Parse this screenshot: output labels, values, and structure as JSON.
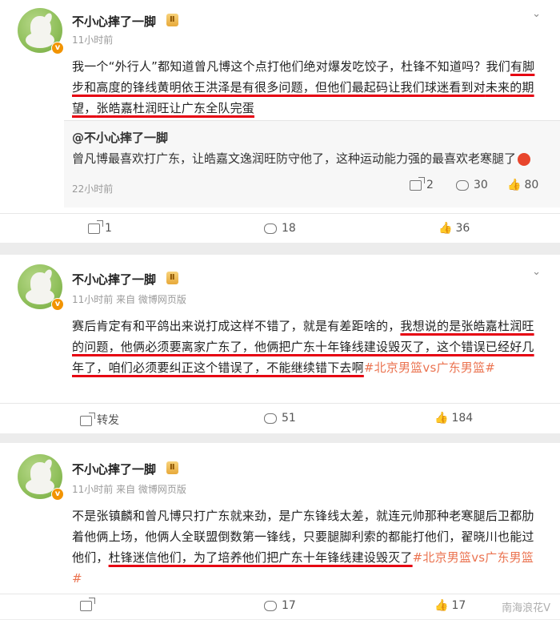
{
  "posts": [
    {
      "user": "不小心摔了一脚",
      "level_badge": "Ⅱ",
      "verify_badge": "v",
      "meta": "11小时前",
      "text": {
        "p1": "我一个“外行人”都知道曾凡博这个点打他们绝对爆发吃饺子，杜锋不知道吗？我们",
        "p2": "有脚步和高度的锋线黄明依王洪泽是有很多问题，但他们最起码让我们球迷看到对",
        "p3": "未来的期望，",
        "p4": "张皓嘉杜润旺让广东全队完蛋"
      },
      "repost": {
        "user": "@不小心摔了一脚",
        "text": "曾凡博最喜欢打广东，让皓嘉文逸润旺防守他了，这种运动能力强的最喜欢老寒腿了",
        "time": "22小时前",
        "share": "2",
        "comment": "30",
        "like": "80"
      },
      "actions": {
        "share": "1",
        "comment": "18",
        "like": "36"
      }
    },
    {
      "user": "不小心摔了一脚",
      "level_badge": "Ⅱ",
      "verify_badge": "v",
      "meta": "11小时前  来自 微博网页版",
      "text": {
        "p1": "赛后肯定有和平鸽出来说打成这样不错了，就是有差距啥的，",
        "p2": "我想说的是张皓嘉杜润旺的问题，他俩必须要离家广东了，他俩把广东十年锋线建设毁灭了，这个错误已经好几年了，咱们必须要纠正这个错误了，不能继续错下去啊",
        "p3": "#北京男篮vs广东男篮#"
      },
      "actions": {
        "share": "转发",
        "comment": "51",
        "like": "184"
      }
    },
    {
      "user": "不小心摔了一脚",
      "level_badge": "Ⅱ",
      "verify_badge": "v",
      "meta": "11小时前  来自 微博网页版",
      "text": {
        "p1": "不是张镇麟和曾凡博只打广东就来劲，是广东锋线太差，就连元帅那种老寒腿后卫都肋着他俩上场，他俩人全联盟倒数第一锋线，只要腿脚利索的都能打他们，翟晓川也能过他们，",
        "p2": "杜锋迷信他们，为了培养他们把广东十年锋线建设毁灭了",
        "p3": "#北京男篮vs广东男篮#"
      },
      "actions": {
        "share": "",
        "comment": "17",
        "like": "17"
      }
    }
  ],
  "watermark": "南海浪花V"
}
